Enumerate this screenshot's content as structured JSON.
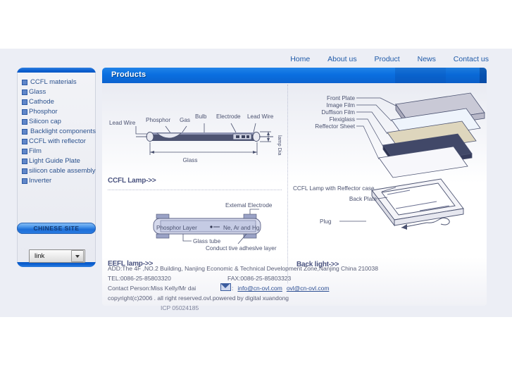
{
  "site": {
    "background_color": "#eceef5",
    "accent_color": "#0b6fd0"
  },
  "topnav": {
    "items": [
      {
        "label": "Home"
      },
      {
        "label": "About us"
      },
      {
        "label": "Product"
      },
      {
        "label": "News"
      },
      {
        "label": "Contact us"
      }
    ]
  },
  "sidebar": {
    "items": [
      {
        "label": "CCFL materials"
      },
      {
        "label": "Glass"
      },
      {
        "label": "Cathode"
      },
      {
        "label": "Phosphor"
      },
      {
        "label": "Silicon cap"
      },
      {
        "label": "Backlight components"
      },
      {
        "label": "CCFL with reflector"
      },
      {
        "label": "Film"
      },
      {
        "label": "Light Guide Plate"
      },
      {
        "label": "silicon cable assembly"
      },
      {
        "label": "Inverter"
      }
    ],
    "chinese_site_label": "CHINESE SITE",
    "link_select": {
      "value": "link",
      "placeholder": "link"
    }
  },
  "main": {
    "header_title": "Products",
    "sections": {
      "ccfl_lamp": "CCFL Lamp->>",
      "eefl_lamp": "EEFL lamp->>",
      "back_light": "Back light->>"
    },
    "ccfl_diagram": {
      "labels": {
        "lead_wire_left": "Lead Wire",
        "phosphor": "Phosphor",
        "gas": "Gas",
        "bulb": "Bulb",
        "electrode": "Electrode",
        "lead_wire_right": "Lead Wire",
        "glass": "Glass",
        "lamp_dia": "lamp Dia"
      }
    },
    "eefl_diagram": {
      "labels": {
        "external_electrode": "Extemal Electrode",
        "phosphor_layer": "Phosphor Layer",
        "gas_mix": "Ne, Ar and Hg",
        "glass_tube": "Glass tube",
        "adhesive": "Conduct tive adheslve layer"
      }
    },
    "backlight_diagram": {
      "labels": {
        "front_plate": "Front Plate",
        "image_film": "Image Film",
        "duffison_film": "Duffison Film",
        "flexiglass": "Flexiglass",
        "reffector_sheet": "Reffector Sheet",
        "ccfl_with_case": "CCFL Lamp with Reffector case",
        "back_plate": "Back  Plate",
        "plug": "Plug"
      }
    }
  },
  "footer": {
    "address": "ADD:The 4F ,NO.2 Building, Nanjing Economic & Technical Development Zone,Nanjing China 210038",
    "tel": "TEL:0086-25-85803320",
    "fax": "FAX:0086-25-85803323",
    "contact_person": "Contact Person:Miss Kelly/Mr dai",
    "email_separator": ":",
    "email1": "info@cn-ovl.com",
    "email2": "ovl@cn-ovl.com",
    "copyright": "copyright(c)2006 . all right reserved.ovl.powered by digital xuandong",
    "icp": "ICP 05024185"
  }
}
